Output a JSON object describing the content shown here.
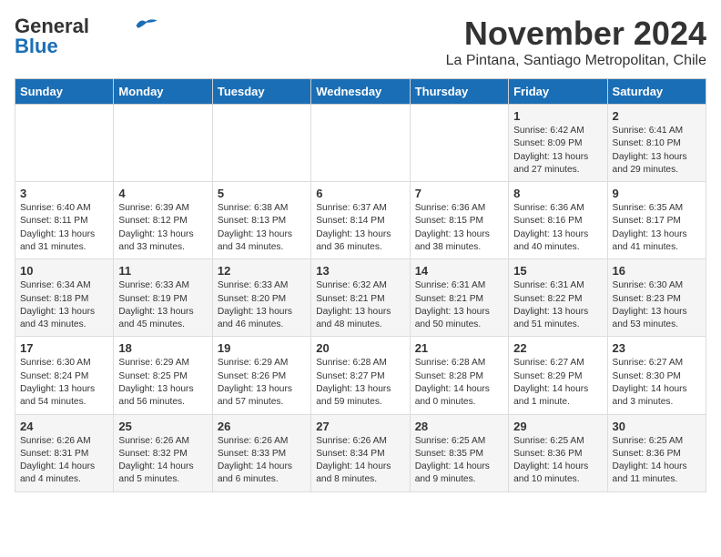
{
  "logo": {
    "line1": "General",
    "line2": "Blue"
  },
  "header": {
    "month": "November 2024",
    "location": "La Pintana, Santiago Metropolitan, Chile"
  },
  "weekdays": [
    "Sunday",
    "Monday",
    "Tuesday",
    "Wednesday",
    "Thursday",
    "Friday",
    "Saturday"
  ],
  "weeks": [
    [
      {
        "day": "",
        "info": ""
      },
      {
        "day": "",
        "info": ""
      },
      {
        "day": "",
        "info": ""
      },
      {
        "day": "",
        "info": ""
      },
      {
        "day": "",
        "info": ""
      },
      {
        "day": "1",
        "info": "Sunrise: 6:42 AM\nSunset: 8:09 PM\nDaylight: 13 hours and 27 minutes."
      },
      {
        "day": "2",
        "info": "Sunrise: 6:41 AM\nSunset: 8:10 PM\nDaylight: 13 hours and 29 minutes."
      }
    ],
    [
      {
        "day": "3",
        "info": "Sunrise: 6:40 AM\nSunset: 8:11 PM\nDaylight: 13 hours and 31 minutes."
      },
      {
        "day": "4",
        "info": "Sunrise: 6:39 AM\nSunset: 8:12 PM\nDaylight: 13 hours and 33 minutes."
      },
      {
        "day": "5",
        "info": "Sunrise: 6:38 AM\nSunset: 8:13 PM\nDaylight: 13 hours and 34 minutes."
      },
      {
        "day": "6",
        "info": "Sunrise: 6:37 AM\nSunset: 8:14 PM\nDaylight: 13 hours and 36 minutes."
      },
      {
        "day": "7",
        "info": "Sunrise: 6:36 AM\nSunset: 8:15 PM\nDaylight: 13 hours and 38 minutes."
      },
      {
        "day": "8",
        "info": "Sunrise: 6:36 AM\nSunset: 8:16 PM\nDaylight: 13 hours and 40 minutes."
      },
      {
        "day": "9",
        "info": "Sunrise: 6:35 AM\nSunset: 8:17 PM\nDaylight: 13 hours and 41 minutes."
      }
    ],
    [
      {
        "day": "10",
        "info": "Sunrise: 6:34 AM\nSunset: 8:18 PM\nDaylight: 13 hours and 43 minutes."
      },
      {
        "day": "11",
        "info": "Sunrise: 6:33 AM\nSunset: 8:19 PM\nDaylight: 13 hours and 45 minutes."
      },
      {
        "day": "12",
        "info": "Sunrise: 6:33 AM\nSunset: 8:20 PM\nDaylight: 13 hours and 46 minutes."
      },
      {
        "day": "13",
        "info": "Sunrise: 6:32 AM\nSunset: 8:21 PM\nDaylight: 13 hours and 48 minutes."
      },
      {
        "day": "14",
        "info": "Sunrise: 6:31 AM\nSunset: 8:21 PM\nDaylight: 13 hours and 50 minutes."
      },
      {
        "day": "15",
        "info": "Sunrise: 6:31 AM\nSunset: 8:22 PM\nDaylight: 13 hours and 51 minutes."
      },
      {
        "day": "16",
        "info": "Sunrise: 6:30 AM\nSunset: 8:23 PM\nDaylight: 13 hours and 53 minutes."
      }
    ],
    [
      {
        "day": "17",
        "info": "Sunrise: 6:30 AM\nSunset: 8:24 PM\nDaylight: 13 hours and 54 minutes."
      },
      {
        "day": "18",
        "info": "Sunrise: 6:29 AM\nSunset: 8:25 PM\nDaylight: 13 hours and 56 minutes."
      },
      {
        "day": "19",
        "info": "Sunrise: 6:29 AM\nSunset: 8:26 PM\nDaylight: 13 hours and 57 minutes."
      },
      {
        "day": "20",
        "info": "Sunrise: 6:28 AM\nSunset: 8:27 PM\nDaylight: 13 hours and 59 minutes."
      },
      {
        "day": "21",
        "info": "Sunrise: 6:28 AM\nSunset: 8:28 PM\nDaylight: 14 hours and 0 minutes."
      },
      {
        "day": "22",
        "info": "Sunrise: 6:27 AM\nSunset: 8:29 PM\nDaylight: 14 hours and 1 minute."
      },
      {
        "day": "23",
        "info": "Sunrise: 6:27 AM\nSunset: 8:30 PM\nDaylight: 14 hours and 3 minutes."
      }
    ],
    [
      {
        "day": "24",
        "info": "Sunrise: 6:26 AM\nSunset: 8:31 PM\nDaylight: 14 hours and 4 minutes."
      },
      {
        "day": "25",
        "info": "Sunrise: 6:26 AM\nSunset: 8:32 PM\nDaylight: 14 hours and 5 minutes."
      },
      {
        "day": "26",
        "info": "Sunrise: 6:26 AM\nSunset: 8:33 PM\nDaylight: 14 hours and 6 minutes."
      },
      {
        "day": "27",
        "info": "Sunrise: 6:26 AM\nSunset: 8:34 PM\nDaylight: 14 hours and 8 minutes."
      },
      {
        "day": "28",
        "info": "Sunrise: 6:25 AM\nSunset: 8:35 PM\nDaylight: 14 hours and 9 minutes."
      },
      {
        "day": "29",
        "info": "Sunrise: 6:25 AM\nSunset: 8:36 PM\nDaylight: 14 hours and 10 minutes."
      },
      {
        "day": "30",
        "info": "Sunrise: 6:25 AM\nSunset: 8:36 PM\nDaylight: 14 hours and 11 minutes."
      }
    ]
  ]
}
